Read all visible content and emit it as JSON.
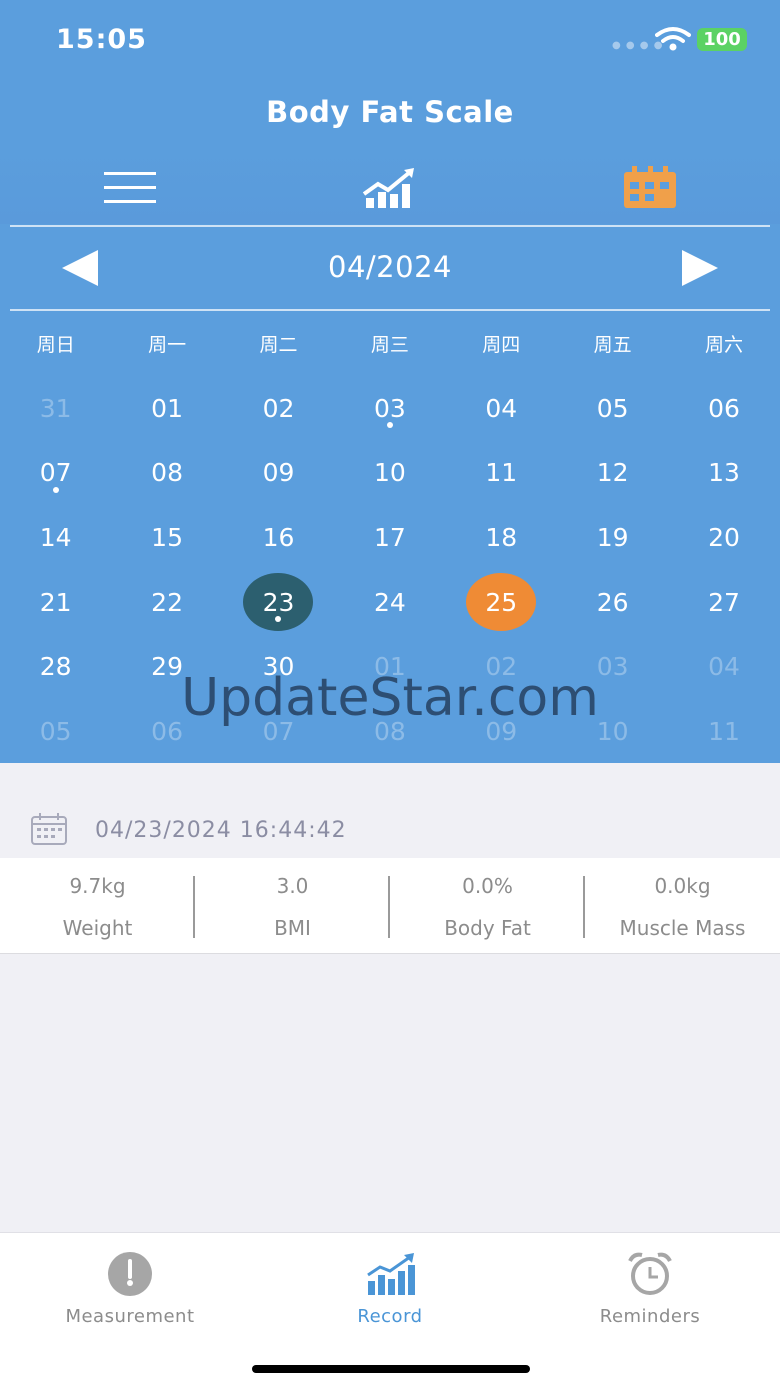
{
  "status_bar": {
    "time": "15:05",
    "battery": "100"
  },
  "header": {
    "title": "Body Fat Scale"
  },
  "toolbar": {
    "icons": [
      "menu-icon",
      "trend-chart-icon",
      "calendar-icon"
    ],
    "active_color": "#f0a04a"
  },
  "calendar": {
    "month_label": "04/2024",
    "weekdays": [
      "周日",
      "周一",
      "周二",
      "周三",
      "周四",
      "周五",
      "周六"
    ],
    "days": [
      {
        "label": "31",
        "muted": true
      },
      {
        "label": "01"
      },
      {
        "label": "02"
      },
      {
        "label": "03",
        "dot": true
      },
      {
        "label": "04"
      },
      {
        "label": "05"
      },
      {
        "label": "06"
      },
      {
        "label": "07",
        "dot": true
      },
      {
        "label": "08"
      },
      {
        "label": "09"
      },
      {
        "label": "10"
      },
      {
        "label": "11"
      },
      {
        "label": "12"
      },
      {
        "label": "13"
      },
      {
        "label": "14"
      },
      {
        "label": "15"
      },
      {
        "label": "16"
      },
      {
        "label": "17"
      },
      {
        "label": "18"
      },
      {
        "label": "19"
      },
      {
        "label": "20"
      },
      {
        "label": "21"
      },
      {
        "label": "22"
      },
      {
        "label": "23",
        "selected": true,
        "dot": true
      },
      {
        "label": "24"
      },
      {
        "label": "25",
        "today": true
      },
      {
        "label": "26"
      },
      {
        "label": "27"
      },
      {
        "label": "28"
      },
      {
        "label": "29"
      },
      {
        "label": "30"
      },
      {
        "label": "01",
        "muted": true
      },
      {
        "label": "02",
        "muted": true
      },
      {
        "label": "03",
        "muted": true
      },
      {
        "label": "04",
        "muted": true
      },
      {
        "label": "05",
        "muted": true
      },
      {
        "label": "06",
        "muted": true
      },
      {
        "label": "07",
        "muted": true
      },
      {
        "label": "08",
        "muted": true
      },
      {
        "label": "09",
        "muted": true
      },
      {
        "label": "10",
        "muted": true
      },
      {
        "label": "11",
        "muted": true
      }
    ],
    "selected_color": "#2c5f6f",
    "today_color": "#ef8b35"
  },
  "watermark": "UpdateStar.com",
  "record": {
    "datetime": "04/23/2024 16:44:42",
    "metrics": [
      {
        "value": "9.7kg",
        "label": "Weight"
      },
      {
        "value": "3.0",
        "label": "BMI"
      },
      {
        "value": "0.0%",
        "label": "Body Fat"
      },
      {
        "value": "0.0kg",
        "label": "Muscle Mass"
      }
    ]
  },
  "tabbar": {
    "tabs": [
      {
        "label": "Measurement",
        "icon": "gauge-icon",
        "active": false
      },
      {
        "label": "Record",
        "icon": "bar-chart-icon",
        "active": true
      },
      {
        "label": "Reminders",
        "icon": "alarm-clock-icon",
        "active": false
      }
    ]
  },
  "colors": {
    "header_bg": "#5b9edd",
    "accent": "#4a95d6",
    "page_bg": "#f0f0f5"
  }
}
